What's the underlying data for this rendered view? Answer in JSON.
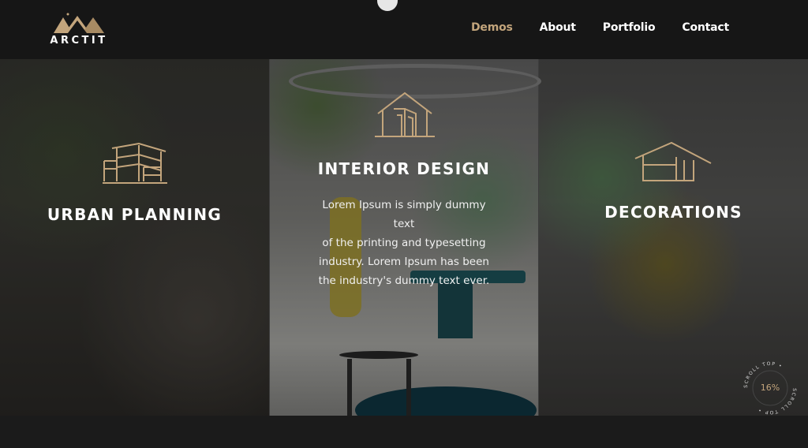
{
  "header": {
    "logo_text": "ARCTIT",
    "nav": [
      {
        "label": "Demos",
        "active": true
      },
      {
        "label": "About"
      },
      {
        "label": "Portfolio"
      },
      {
        "label": "Contact"
      }
    ]
  },
  "services": [
    {
      "title": "URBAN PLANNING",
      "icon": "building-icon"
    },
    {
      "title": "INTERIOR DESIGN",
      "icon": "house-interior-icon",
      "description": "Lorem Ipsum is simply dummy\ntext\nof the printing and typesetting\nindustry. Lorem Ipsum has been\nthe industry's dummy text ever."
    },
    {
      "title": "DECORATIONS",
      "icon": "house-outline-icon"
    }
  ],
  "scroll_top": {
    "label": "SCROLL TOP",
    "percent": "16%",
    "progress": 0.16
  },
  "colors": {
    "accent": "#c3a57c",
    "header_bg": "#161616",
    "text": "#ffffff"
  }
}
